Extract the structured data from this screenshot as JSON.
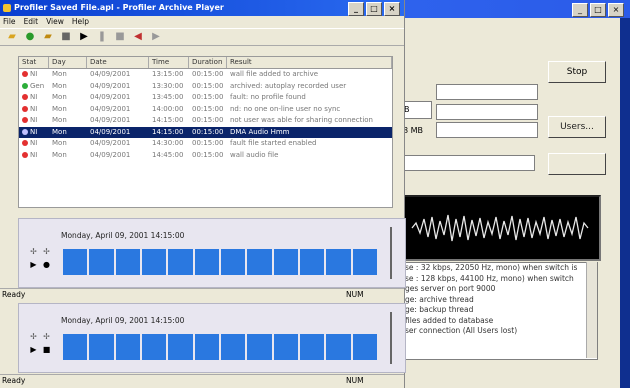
{
  "background_window": {
    "buttons": {
      "stop": "Stop",
      "users": "Users..."
    },
    "fields": {
      "partial_value": "B",
      "size_text": "8 MB"
    },
    "log_lines": [
      "se : 32 kbps, 22050 Hz, mono) when switch is",
      "se : 128 kbps, 44100 Hz, mono) when switch",
      "ges server on port 9000",
      "ge: archive thread",
      "ge: backup thread",
      "files added to database",
      "ser connection (All Users lost)"
    ]
  },
  "main_window": {
    "title": "Profiler Saved File.apl - Profiler Archive Player",
    "menu": [
      "File",
      "Edit",
      "View",
      "Help"
    ],
    "columns": [
      "Stat",
      "Day",
      "Date",
      "Time",
      "Duration",
      "Result"
    ],
    "rows": [
      {
        "stat": "NI",
        "day": "Mon",
        "date": "04/09/2001",
        "time": "13:15:00",
        "duration": "00:15:00",
        "result": "wall file added to archive",
        "color": "#e33030",
        "selected": false
      },
      {
        "stat": "Gen",
        "day": "Mon",
        "date": "04/09/2001",
        "time": "13:30:00",
        "duration": "00:15:00",
        "result": "archived: autoplay recorded user",
        "color": "#2cae3a",
        "selected": false
      },
      {
        "stat": "NI",
        "day": "Mon",
        "date": "04/09/2001",
        "time": "13:45:00",
        "duration": "00:15:00",
        "result": "fault: no profile found",
        "color": "#e33030",
        "selected": false
      },
      {
        "stat": "NI",
        "day": "Mon",
        "date": "04/09/2001",
        "time": "14:00:00",
        "duration": "00:15:00",
        "result": "nd: no one on-line user no sync",
        "color": "#e33030",
        "selected": false
      },
      {
        "stat": "NI",
        "day": "Mon",
        "date": "04/09/2001",
        "time": "14:15:00",
        "duration": "00:15:00",
        "result": "not user was able for sharing connection",
        "color": "#e33030",
        "selected": false
      },
      {
        "stat": "NI",
        "day": "Mon",
        "date": "04/09/2001",
        "time": "14:15:00",
        "duration": "00:15:00",
        "result": "DMA Audio Hmm",
        "color": "#c0c0ff",
        "selected": true
      },
      {
        "stat": "NI",
        "day": "Mon",
        "date": "04/09/2001",
        "time": "14:30:00",
        "duration": "00:15:00",
        "result": "fault file started enabled",
        "color": "#e33030",
        "selected": false
      },
      {
        "stat": "NI",
        "day": "Mon",
        "date": "04/09/2001",
        "time": "14:45:00",
        "duration": "00:15:00",
        "result": "wall audio file",
        "color": "#e33030",
        "selected": false
      }
    ],
    "panels": [
      {
        "date": "Monday, April 09, 2001 14:15:00"
      },
      {
        "date": "Monday, April 09, 2001 14:15:00"
      }
    ],
    "status": {
      "left": "Ready",
      "right": "NUM"
    }
  },
  "colors": {
    "accent": "#0a246a",
    "track": "#2a78e0",
    "titlebar": "#0a3fd0"
  }
}
